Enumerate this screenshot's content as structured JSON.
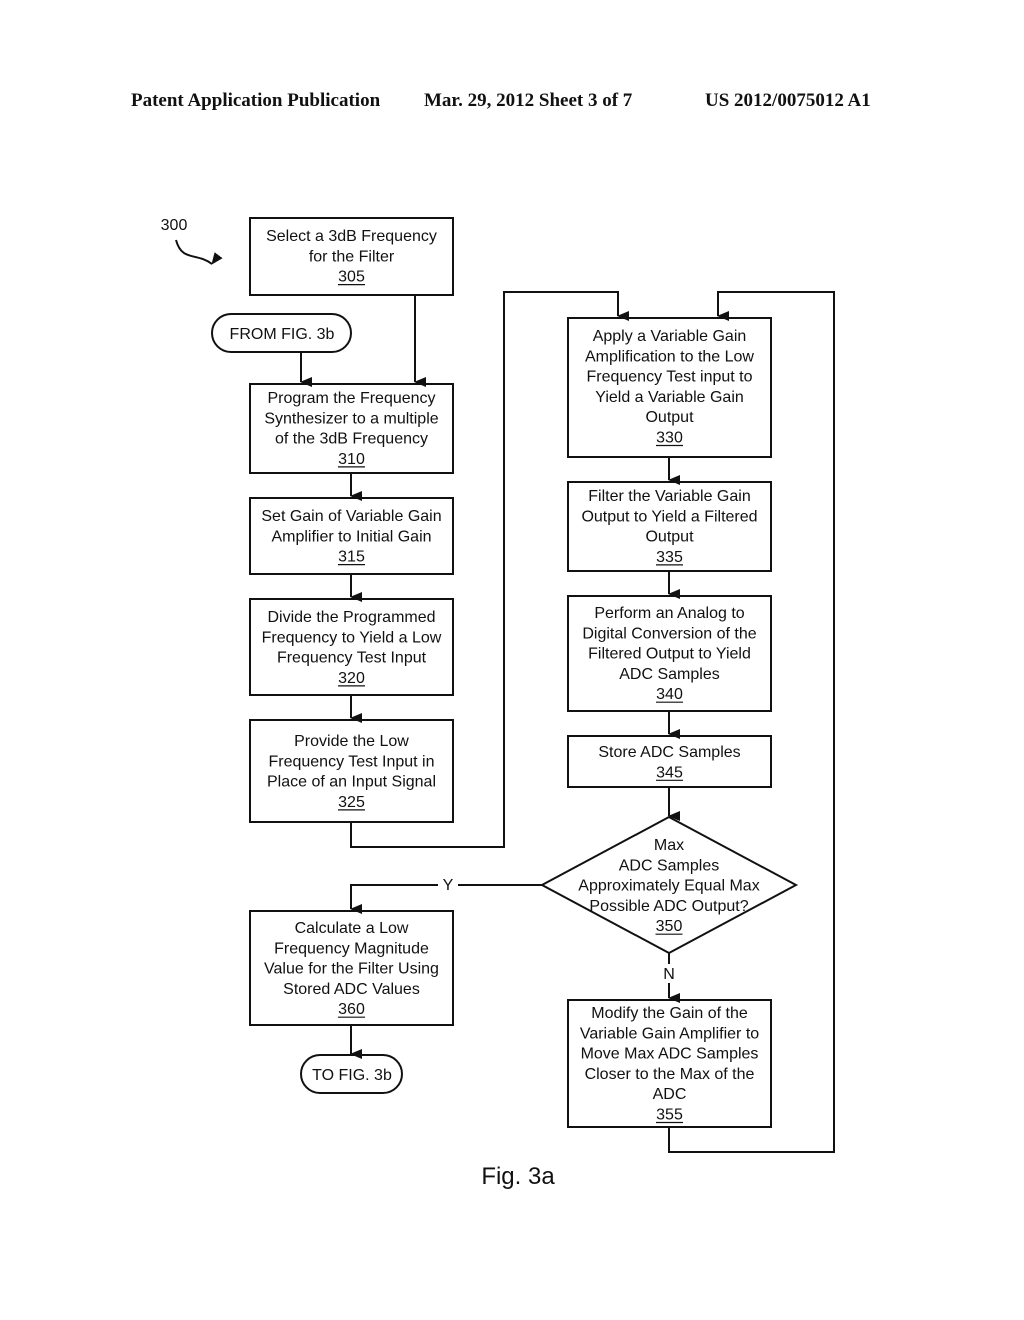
{
  "header": {
    "left": "Patent Application Publication",
    "center": "Mar. 29, 2012  Sheet 3 of 7",
    "right": "US 2012/0075012 A1"
  },
  "figure": {
    "ref": "300",
    "caption": "Fig. 3a"
  },
  "connectors": {
    "from": "FROM FIG. 3b",
    "to": "TO FIG. 3b"
  },
  "branches": {
    "yes": "Y",
    "no": "N"
  },
  "steps": {
    "s305": {
      "lines": [
        "Select a 3dB Frequency",
        "for the Filter"
      ],
      "num": "305"
    },
    "s310": {
      "lines": [
        "Program the Frequency",
        "Synthesizer to a multiple",
        "of the 3dB Frequency"
      ],
      "num": "310"
    },
    "s315": {
      "lines": [
        "Set Gain of Variable Gain",
        "Amplifier to Initial Gain"
      ],
      "num": "315"
    },
    "s320": {
      "lines": [
        "Divide the Programmed",
        "Frequency to Yield a Low",
        "Frequency Test Input"
      ],
      "num": "320"
    },
    "s325": {
      "lines": [
        "Provide the Low",
        "Frequency Test Input in",
        "Place of an Input Signal"
      ],
      "num": "325"
    },
    "s330": {
      "lines": [
        "Apply a Variable Gain",
        "Amplification to the Low",
        "Frequency Test input to",
        "Yield a Variable Gain",
        "Output"
      ],
      "num": "330"
    },
    "s335": {
      "lines": [
        "Filter the Variable Gain",
        "Output to Yield a Filtered",
        "Output"
      ],
      "num": "335"
    },
    "s340": {
      "lines": [
        "Perform an Analog to",
        "Digital Conversion of the",
        "Filtered Output to Yield",
        "ADC Samples"
      ],
      "num": "340"
    },
    "s345": {
      "lines": [
        "Store ADC Samples"
      ],
      "num": "345"
    },
    "s350": {
      "lines": [
        "Max",
        "ADC Samples",
        "Approximately Equal Max",
        "Possible ADC Output?"
      ],
      "num": "350"
    },
    "s355": {
      "lines": [
        "Modify the Gain of the",
        "Variable Gain Amplifier to",
        "Move Max ADC Samples",
        "Closer to the Max of the",
        "ADC"
      ],
      "num": "355"
    },
    "s360": {
      "lines": [
        "Calculate a Low",
        "Frequency Magnitude",
        "Value for the Filter Using",
        "Stored ADC Values"
      ],
      "num": "360"
    }
  }
}
